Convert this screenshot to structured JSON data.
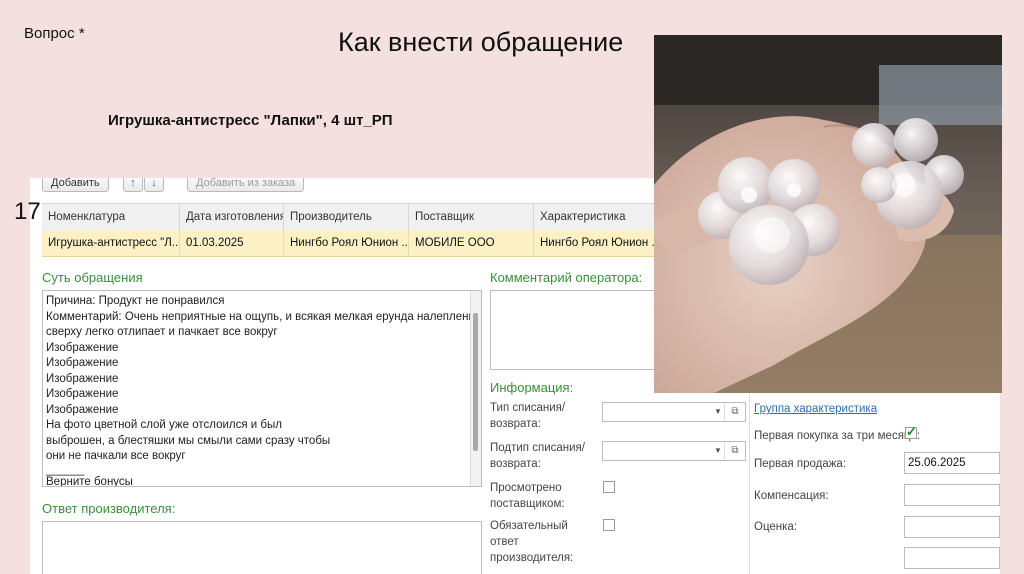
{
  "slide": {
    "question_label": "Вопрос *",
    "title": "Как внести обращение",
    "subtitle": "Игрушка-антистресс \"Лапки\", 4 шт_РП",
    "slide_number": "17"
  },
  "toolbar": {
    "add_label": "Добавить",
    "up_icon": "arrow-up-icon",
    "down_icon": "arrow-down-icon",
    "add_from_order_label": "Добавить из заказа"
  },
  "table": {
    "columns": [
      "Номенклатура",
      "Дата изготовления",
      "Производитель",
      "Поставщик",
      "Характеристика"
    ],
    "rows": [
      [
        "Игрушка-антистресс \"Л...",
        "01.03.2025",
        "Нингбо Роял Юнион ...",
        "МОБИЛЕ ООО",
        "Нингбо Роял Юнион ..."
      ]
    ]
  },
  "essence": {
    "label": "Суть обращения",
    "lines": [
      "Причина: Продукт не понравился",
      "Комментарий: Очень неприятные на ощупь, и всякая мелкая ерунда налепленная",
      "сверху легко отлипает и пачкает все вокруг",
      "Изображение",
      "Изображение",
      "Изображение",
      "Изображение",
      "Изображение",
      "На фото цветной слой уже отслоился и был",
      "выброшен, а блестяшки мы смыли сами сразу чтобы",
      "они не пачкали все вокруг",
      "______",
      "Верните бонусы"
    ]
  },
  "producer_answer": {
    "label": "Ответ производителя:"
  },
  "operator_comment": {
    "label": "Комментарий оператора:"
  },
  "info": {
    "label": "Информация:",
    "type_label": "Тип списания/возврата:",
    "subtype_label": "Подтип списания/возврата:",
    "viewed_label": "Просмотрено поставщиком:",
    "required_label": "Обязательный ответ производителя:"
  },
  "right_panel": {
    "group_link": "Группа характеристика",
    "first_purchase_label": "Первая покупка за три месяца:",
    "first_purchase_checked": true,
    "first_sale_label": "Первая продажа:",
    "first_sale_value": "25.06.2025",
    "compensation_label": "Компенсация:",
    "rating_label": "Оценка:"
  },
  "colors": {
    "accent_green": "#3a8f3a",
    "row_highlight": "#fbf1c5",
    "slide_bg": "#f5e0e0"
  }
}
